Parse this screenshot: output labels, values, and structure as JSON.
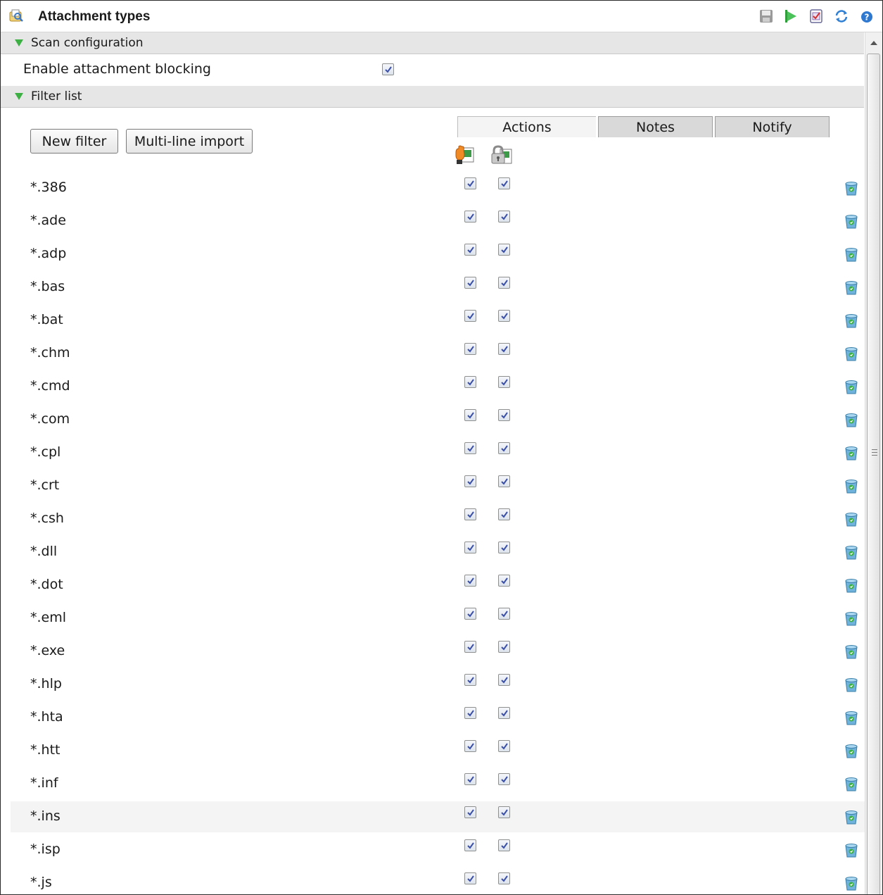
{
  "header": {
    "title": "Attachment types",
    "toolbar_icons": [
      "save-icon",
      "apply-icon",
      "checklist-icon",
      "refresh-icon",
      "help-icon"
    ]
  },
  "scan_section": {
    "title": "Scan configuration",
    "enable_label": "Enable attachment blocking",
    "enable_checked": true
  },
  "filter_section": {
    "title": "Filter list",
    "new_filter_label": "New filter",
    "multiline_import_label": "Multi-line import",
    "tabs": [
      {
        "label": "Actions",
        "active": true
      },
      {
        "label": "Notes",
        "active": false
      },
      {
        "label": "Notify",
        "active": false
      }
    ],
    "column_icons": [
      "block-hand-icon",
      "quarantine-lock-icon"
    ],
    "rows": [
      {
        "name": "*.386",
        "block": true,
        "quarantine": true
      },
      {
        "name": "*.ade",
        "block": true,
        "quarantine": true
      },
      {
        "name": "*.adp",
        "block": true,
        "quarantine": true
      },
      {
        "name": "*.bas",
        "block": true,
        "quarantine": true
      },
      {
        "name": "*.bat",
        "block": true,
        "quarantine": true
      },
      {
        "name": "*.chm",
        "block": true,
        "quarantine": true
      },
      {
        "name": "*.cmd",
        "block": true,
        "quarantine": true
      },
      {
        "name": "*.com",
        "block": true,
        "quarantine": true
      },
      {
        "name": "*.cpl",
        "block": true,
        "quarantine": true
      },
      {
        "name": "*.crt",
        "block": true,
        "quarantine": true
      },
      {
        "name": "*.csh",
        "block": true,
        "quarantine": true
      },
      {
        "name": "*.dll",
        "block": true,
        "quarantine": true
      },
      {
        "name": "*.dot",
        "block": true,
        "quarantine": true
      },
      {
        "name": "*.eml",
        "block": true,
        "quarantine": true
      },
      {
        "name": "*.exe",
        "block": true,
        "quarantine": true
      },
      {
        "name": "*.hlp",
        "block": true,
        "quarantine": true
      },
      {
        "name": "*.hta",
        "block": true,
        "quarantine": true
      },
      {
        "name": "*.htt",
        "block": true,
        "quarantine": true
      },
      {
        "name": "*.inf",
        "block": true,
        "quarantine": true
      },
      {
        "name": "*.ins",
        "block": true,
        "quarantine": true,
        "highlighted": true
      },
      {
        "name": "*.isp",
        "block": true,
        "quarantine": true
      },
      {
        "name": "*.js",
        "block": true,
        "quarantine": true
      }
    ]
  }
}
